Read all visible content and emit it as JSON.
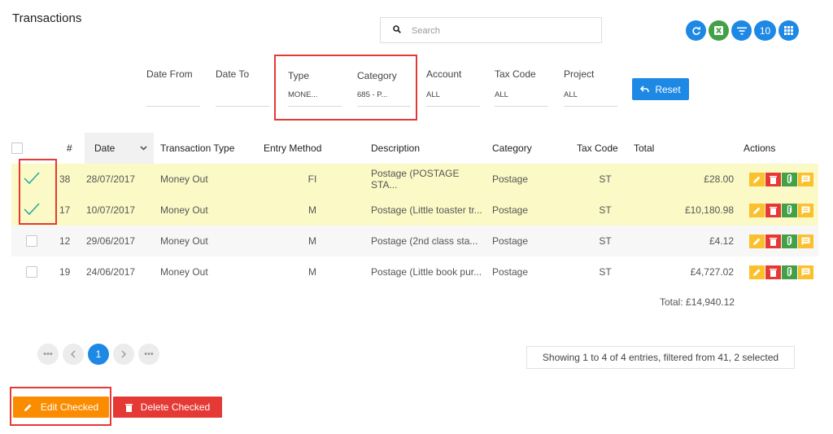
{
  "header": {
    "title": "Transactions"
  },
  "search": {
    "placeholder": "Search"
  },
  "toolbar": [
    {
      "name": "refresh-button",
      "icon": "refresh-icon",
      "color": "#1e88e5"
    },
    {
      "name": "excel-export-button",
      "icon": "excel-icon",
      "color": "#43a047"
    },
    {
      "name": "filter-button",
      "icon": "filter-icon",
      "color": "#1e88e5"
    },
    {
      "name": "page-size-button",
      "label": "10",
      "color": "#1e88e5"
    },
    {
      "name": "grid-view-button",
      "icon": "grid-icon",
      "color": "#1e88e5"
    }
  ],
  "filters": {
    "date_from": {
      "label": "Date From",
      "value": ""
    },
    "date_to": {
      "label": "Date To",
      "value": ""
    },
    "type": {
      "label": "Type",
      "value": "MONE..."
    },
    "category": {
      "label": "Category",
      "value": "685 - P..."
    },
    "account": {
      "label": "Account",
      "value": "ALL"
    },
    "tax_code": {
      "label": "Tax Code",
      "value": "ALL"
    },
    "project": {
      "label": "Project",
      "value": "ALL"
    },
    "reset_label": "Reset"
  },
  "table": {
    "columns": {
      "num": "#",
      "date": "Date",
      "type": "Transaction Type",
      "method": "Entry Method",
      "description": "Description",
      "category": "Category",
      "tax": "Tax Code",
      "total": "Total",
      "actions": "Actions"
    },
    "rows": [
      {
        "checked": true,
        "num": "38",
        "date": "28/07/2017",
        "type": "Money Out",
        "method": "FI",
        "description": "Postage (POSTAGE STA...",
        "category": "Postage",
        "tax": "ST",
        "total": "£28.00"
      },
      {
        "checked": true,
        "num": "17",
        "date": "10/07/2017",
        "type": "Money Out",
        "method": "M",
        "description": "Postage (Little toaster tr...",
        "category": "Postage",
        "tax": "ST",
        "total": "£10,180.98"
      },
      {
        "checked": false,
        "num": "12",
        "date": "29/06/2017",
        "type": "Money Out",
        "method": "M",
        "description": "Postage (2nd class sta...",
        "category": "Postage",
        "tax": "ST",
        "total": "£4.12"
      },
      {
        "checked": false,
        "num": "19",
        "date": "24/06/2017",
        "type": "Money Out",
        "method": "M",
        "description": "Postage (Little book pur...",
        "category": "Postage",
        "tax": "ST",
        "total": "£4,727.02"
      }
    ],
    "grand_total": "Total: £14,940.12"
  },
  "pagination": {
    "first": "•••",
    "current": "1",
    "last": "•••"
  },
  "info": "Showing 1 to 4 of 4 entries, filtered from 41, 2 selected",
  "actions": {
    "edit_label": "Edit Checked",
    "delete_label": "Delete Checked"
  },
  "colors": {
    "accent": "#1e88e5",
    "edit": "#fb8c00",
    "delete": "#e53935",
    "selected_row": "#fbfac6",
    "link": "#2e8ee8",
    "check": "#26a69a",
    "highlight_box": "#e53935"
  }
}
